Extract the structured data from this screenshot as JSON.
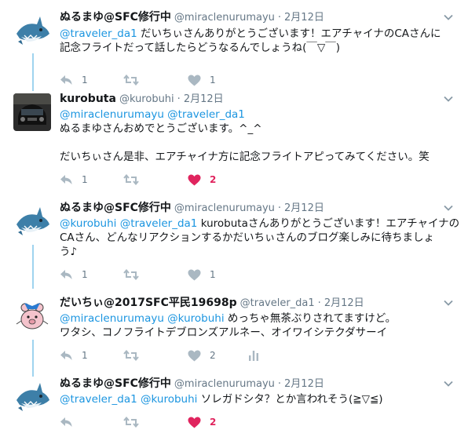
{
  "tweets": [
    {
      "name": "ぬるまゆ@SFC修行中",
      "handle": "@miraclenurumayu",
      "dot": "·",
      "date": "2月12日",
      "avatar": "shark-avatar",
      "segments": [
        {
          "mention": "@traveler_da1",
          "text": " だいちぃさんありがとうございます！エアチャイナのCAさんに"
        },
        {
          "mention": "",
          "text": "記念フライトだって話したらどうなるんでしょうね(￣▽￣)"
        }
      ],
      "reply_count": "1",
      "retweet_count": "",
      "like_count": "1",
      "liked": false
    },
    {
      "name": "kurobuta",
      "handle": "@kurobuhi",
      "dot": "·",
      "date": "2月12日",
      "avatar": "car-photo-avatar",
      "segments": [
        {
          "mention": "@miraclenurumayu @traveler_da1",
          "text": ""
        },
        {
          "mention": "",
          "text": "ぬるまゆさんおめでとうございます。^_^"
        },
        {
          "mention": "",
          "text": ""
        },
        {
          "mention": "",
          "text": "だいちぃさん是非、エアチャイナ方に記念フライトアピってみてください。笑"
        }
      ],
      "reply_count": "1",
      "retweet_count": "",
      "like_count": "2",
      "liked": true
    },
    {
      "name": "ぬるまゆ@SFC修行中",
      "handle": "@miraclenurumayu",
      "dot": "·",
      "date": "2月12日",
      "avatar": "shark-avatar",
      "segments": [
        {
          "mention": "@kurobuhi @traveler_da1",
          "text": " kurobutaさんありがとうございます！エアチャイナの"
        },
        {
          "mention": "",
          "text": "CAさん、どんなリアクションするかだいちぃさんのブログ楽しみに待ちましょ"
        },
        {
          "mention": "",
          "text": "う♪"
        }
      ],
      "reply_count": "1",
      "retweet_count": "",
      "like_count": "1",
      "liked": false
    },
    {
      "name": "だいちぃ@2017SFC平民19698p",
      "handle": "@traveler_da1",
      "dot": "·",
      "date": "2月12日",
      "avatar": "pig-avatar",
      "segments": [
        {
          "mention": "@miraclenurumayu @kurobuhi",
          "text": " めっちゃ無茶ぶりされてますけど。"
        },
        {
          "mention": "",
          "text": "ワタシ、コノフライトデブロンズアルネー、オイワイシテクダサーイ"
        }
      ],
      "reply_count": "1",
      "retweet_count": "",
      "like_count": "2",
      "liked": false,
      "analytics": true
    },
    {
      "name": "ぬるまゆ@SFC修行中",
      "handle": "@miraclenurumayu",
      "dot": "·",
      "date": "2月12日",
      "avatar": "shark-avatar",
      "segments": [
        {
          "mention": "@traveler_da1 @kurobuhi",
          "text": " ソレガドシタ？とか言われそう(≧▽≦)"
        }
      ],
      "reply_count": "",
      "retweet_count": "",
      "like_count": "2",
      "liked": true
    }
  ],
  "colors": {
    "mention": "#1b95e0",
    "meta": "#657786",
    "like_active": "#e0245e",
    "thread_line": "#9fd3ef"
  },
  "icons": {
    "reply": "reply-icon",
    "retweet": "retweet-icon",
    "like": "heart-icon",
    "analytics": "analytics-icon",
    "menu": "chevron-down-icon"
  }
}
